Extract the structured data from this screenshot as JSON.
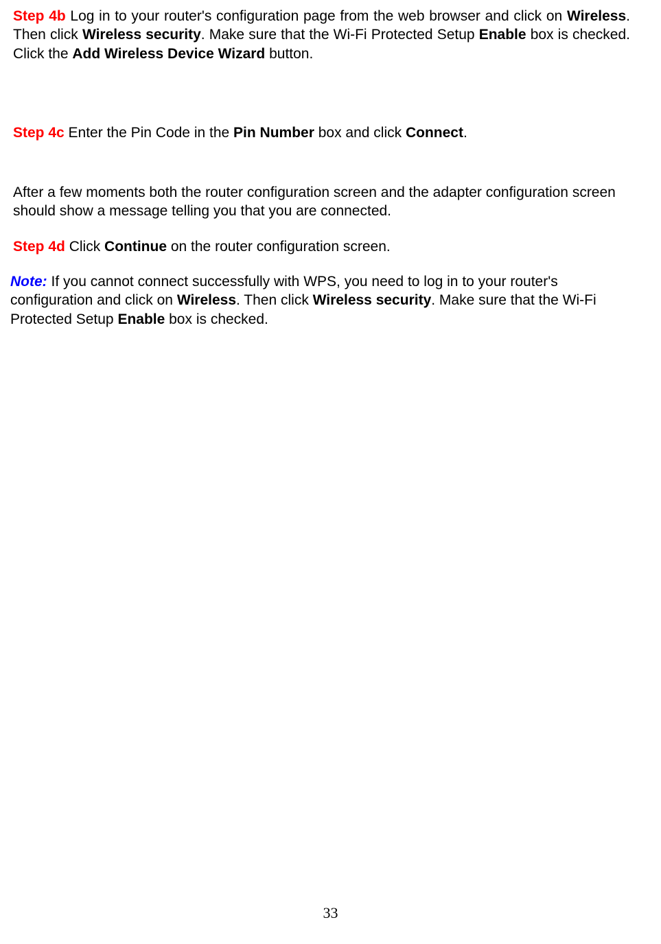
{
  "step4b": {
    "label": "Step 4b",
    "t1": " Log in to your router's configuration page from the web browser and click on ",
    "b1": "Wireless",
    "t2": ".  Then click ",
    "b2": "Wireless security",
    "t3": ".  Make sure that the Wi-Fi Protected Setup ",
    "b3": "Enable",
    "t4": " box is checked.    Click the ",
    "b4": "Add Wireless Device Wizard",
    "t5": " button."
  },
  "step4c": {
    "label": "Step 4c",
    "t1": " Enter the Pin Code in the ",
    "b1": "Pin Number",
    "t2": " box and click ",
    "b2": "Connect",
    "t3": "."
  },
  "after": "After a few moments both the router configuration screen and the adapter configuration screen should show a message telling you that you are connected.",
  "step4d": {
    "label": "Step 4d",
    "t1": " Click ",
    "b1": "Continue",
    "t2": " on the router configuration screen."
  },
  "note": {
    "label": "Note:",
    "t1": " If you cannot connect successfully with WPS, you need to log in to your router's configuration and click on ",
    "b1": "Wireless",
    "t2": ".    Then click ",
    "b2": "Wireless security",
    "t3": ".    Make sure that the Wi-Fi Protected Setup ",
    "b3": "Enable",
    "t4": " box is checked."
  },
  "pageNumber": "33"
}
